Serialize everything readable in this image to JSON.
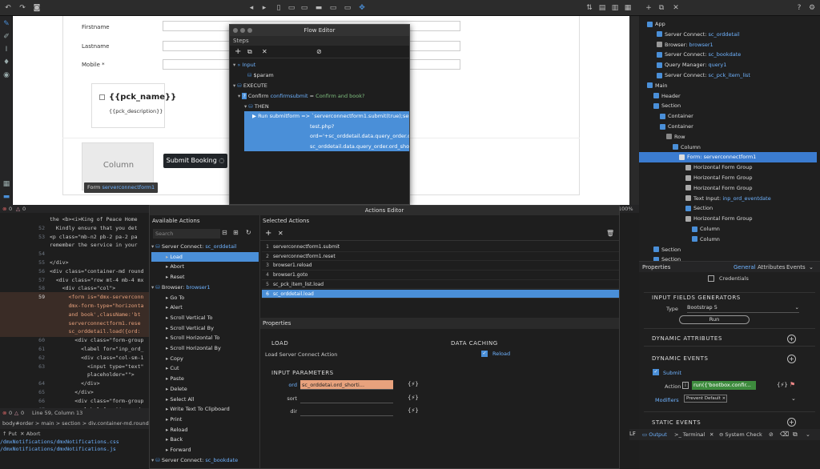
{
  "canvas": {
    "firstname_label": "Firstname",
    "lastname_label": "Lastname",
    "mobile_label": "Mobile *",
    "pck_name": "{{pck_name}}",
    "pck_description": "{{pck_description}}",
    "column_label": "Column",
    "submit_label": "Submit Booking",
    "form_tag_prefix": "Form",
    "form_tag_name": "serverconnectform1"
  },
  "flow_editor": {
    "title": "Flow Editor",
    "steps_label": "Steps",
    "input_label": "Input",
    "param_label": "$param",
    "execute_label": "EXECUTE",
    "confirm_label": "Confirm",
    "confirm_name": "confirmsubmit",
    "confirm_sep": "=",
    "confirm_value": "Confirm and book?",
    "then_label": "THEN",
    "run_line1": "Run submitform => `serverconnectform1.submit(true);serverc",
    "run_line2": "test.php?",
    "run_line3": "ord='+sc_orddetail.data.query_order.ord_",
    "run_line4": "sc_orddetail.data.query_order.ord_shortic"
  },
  "status": {
    "zoom": "100%",
    "line_col": "Line 59, Column 13",
    "errors": "0",
    "warnings": "0",
    "encoding": "LF"
  },
  "code_lines": [
    {
      "num": "",
      "text": "the <b><i>King of Peace Home"
    },
    {
      "num": "52",
      "text": "  Kindly ensure that you det"
    },
    {
      "num": "53",
      "text": "<p class=\"mb-n2 pb-2 pa-2 pa"
    },
    {
      "num": "",
      "text": "remember the service in your"
    },
    {
      "num": "54",
      "text": ""
    },
    {
      "num": "55",
      "text": "</div>"
    },
    {
      "num": "56",
      "text": "<div class=\"container-md round"
    },
    {
      "num": "57",
      "text": "  <div class=\"row mt-4 mb-4 mx"
    },
    {
      "num": "58",
      "text": "    <div class=\"col\">"
    },
    {
      "num": "59",
      "text": "      <form is=\"dmx-serverconn"
    },
    {
      "num": "",
      "text": "      dmx-form-type=\"horizonta"
    },
    {
      "num": "",
      "text": "      and book',className:'bt"
    },
    {
      "num": "",
      "text": "      serverconnectform1.rese"
    },
    {
      "num": "",
      "text": "      sc_orddetail.load({ord:"
    },
    {
      "num": "60",
      "text": "        <div class=\"form-group"
    },
    {
      "num": "61",
      "text": "          <label for=\"inp_ord_"
    },
    {
      "num": "62",
      "text": "          <div class=\"col-sm-1"
    },
    {
      "num": "63",
      "text": "            <input type=\"text\""
    },
    {
      "num": "",
      "text": "            placeholder=\"\">"
    },
    {
      "num": "64",
      "text": "          </div>"
    },
    {
      "num": "65",
      "text": "        </div>"
    },
    {
      "num": "66",
      "text": "        <div class=\"form-group"
    },
    {
      "num": "67",
      "text": "          <label for=\"inp_ord_"
    }
  ],
  "breadcrumb": "body#order > main > section > div.container-md.rounded >",
  "bottom": {
    "put_label": "Put",
    "abort_label": "Abort",
    "path1": "/dmxNotifications/dmxNotifications.css",
    "path2": "/dmxNotifications/dmxNotifications.js"
  },
  "actions_editor": {
    "title": "Actions Editor",
    "available_label": "Available Actions",
    "selected_label": "Selected Actions",
    "search_placeholder": "Search",
    "available": [
      {
        "label": "Server Connect:",
        "name": "sc_orddetail",
        "group": true
      },
      {
        "label": "Load",
        "selected": true
      },
      {
        "label": "Abort"
      },
      {
        "label": "Reset"
      },
      {
        "label": "Browser:",
        "name": "browser1",
        "group": true
      },
      {
        "label": "Go To"
      },
      {
        "label": "Alert"
      },
      {
        "label": "Scroll Vertical To"
      },
      {
        "label": "Scroll Vertical By"
      },
      {
        "label": "Scroll Horizontal To"
      },
      {
        "label": "Scroll Horizontal By"
      },
      {
        "label": "Copy"
      },
      {
        "label": "Cut"
      },
      {
        "label": "Paste"
      },
      {
        "label": "Delete"
      },
      {
        "label": "Select All"
      },
      {
        "label": "Write Text To Clipboard"
      },
      {
        "label": "Print"
      },
      {
        "label": "Reload"
      },
      {
        "label": "Back"
      },
      {
        "label": "Forward"
      },
      {
        "label": "Server Connect:",
        "name": "sc_bookdate",
        "group": true
      }
    ],
    "selected": [
      {
        "num": "1",
        "label": "serverconnectform1.submit"
      },
      {
        "num": "2",
        "label": "serverconnectform1.reset"
      },
      {
        "num": "3",
        "label": "browser1.reload"
      },
      {
        "num": "4",
        "label": "browser1.goto"
      },
      {
        "num": "5",
        "label": "sc_pck_item_list.load"
      },
      {
        "num": "6",
        "label": "sc_orddetail.load",
        "selected": true
      }
    ],
    "properties_label": "Properties",
    "load_header": "LOAD",
    "load_desc": "Load Server Connect Action",
    "caching_header": "DATA CACHING",
    "reload_label": "Reload",
    "input_params_header": "INPUT PARAMETERS",
    "params": [
      {
        "label": "ord",
        "value": "sc_orddetai.ord_shorti..."
      },
      {
        "label": "sort",
        "value": ""
      },
      {
        "label": "dir",
        "value": ""
      }
    ]
  },
  "app_tree": {
    "items": [
      {
        "label": "App",
        "name": ""
      },
      {
        "label": "Server Connect:",
        "name": "sc_orddetail"
      },
      {
        "label": "Browser:",
        "name": "browser1"
      },
      {
        "label": "Server Connect:",
        "name": "sc_bookdate"
      },
      {
        "label": "Query Manager:",
        "name": "query1"
      },
      {
        "label": "Server Connect:",
        "name": "sc_pck_item_list"
      },
      {
        "label": "Main",
        "name": ""
      },
      {
        "label": "Header",
        "name": ""
      },
      {
        "label": "Section",
        "name": ""
      },
      {
        "label": "Container",
        "name": ""
      },
      {
        "label": "Container",
        "name": ""
      },
      {
        "label": "Row",
        "name": ""
      },
      {
        "label": "Column",
        "name": ""
      },
      {
        "label": "Form:",
        "name": "serverconnectform1"
      },
      {
        "label": "Horizontal Form Group",
        "name": ""
      },
      {
        "label": "Horizontal Form Group",
        "name": ""
      },
      {
        "label": "Horizontal Form Group",
        "name": ""
      },
      {
        "label": "Text Input:",
        "name": "inp_ord_eventdate"
      },
      {
        "label": "Section",
        "name": ""
      },
      {
        "label": "Horizontal Form Group",
        "name": ""
      },
      {
        "label": "Column",
        "name": ""
      },
      {
        "label": "Column",
        "name": ""
      },
      {
        "label": "Section",
        "name": ""
      },
      {
        "label": "Section",
        "name": ""
      }
    ]
  },
  "properties": {
    "title": "Properties",
    "tabs": [
      "General",
      "Attributes",
      "Events"
    ],
    "credentials_label": "Credentials",
    "input_generators": "INPUT FIELDS GENERATORS",
    "type_label": "Type",
    "type_value": "Bootstrap 5",
    "run_label": "Run",
    "dynamic_attributes": "DYNAMIC ATTRIBUTES",
    "dynamic_events": "DYNAMIC EVENTS",
    "submit_label": "Submit",
    "action_label": "Action",
    "action_value": "run({'bootbox.confir...",
    "modifiers_label": "Modifiers",
    "modifier_value": "Prevent Default",
    "static_events": "STATIC EVENTS"
  },
  "right_bottom": {
    "output_label": "Output",
    "terminal_label": "Terminal",
    "system_check_label": "System Check"
  },
  "colors": {
    "accent": "#4a8fd8",
    "selection": "#3b7cd0",
    "name_blue": "#6fb3ff",
    "green": "#3d8b3d",
    "orange_param": "#e8a27d"
  }
}
